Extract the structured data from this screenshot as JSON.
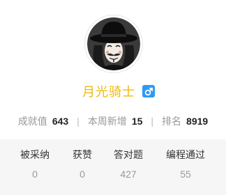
{
  "profile": {
    "username": "月光骑士",
    "gender_icon": "male-symbol-icon",
    "colors": {
      "username": "#f0b90b",
      "gender_badge": "#2f9af5"
    }
  },
  "stats": [
    {
      "label": "成就值",
      "value": "643"
    },
    {
      "label": "本周新增",
      "value": "15"
    },
    {
      "label": "排名",
      "value": "8919"
    }
  ],
  "separator": "|",
  "counters": [
    {
      "label": "被采纳",
      "value": "0"
    },
    {
      "label": "获赞",
      "value": "0"
    },
    {
      "label": "答对题",
      "value": "427"
    },
    {
      "label": "编程通过",
      "value": "55"
    }
  ]
}
